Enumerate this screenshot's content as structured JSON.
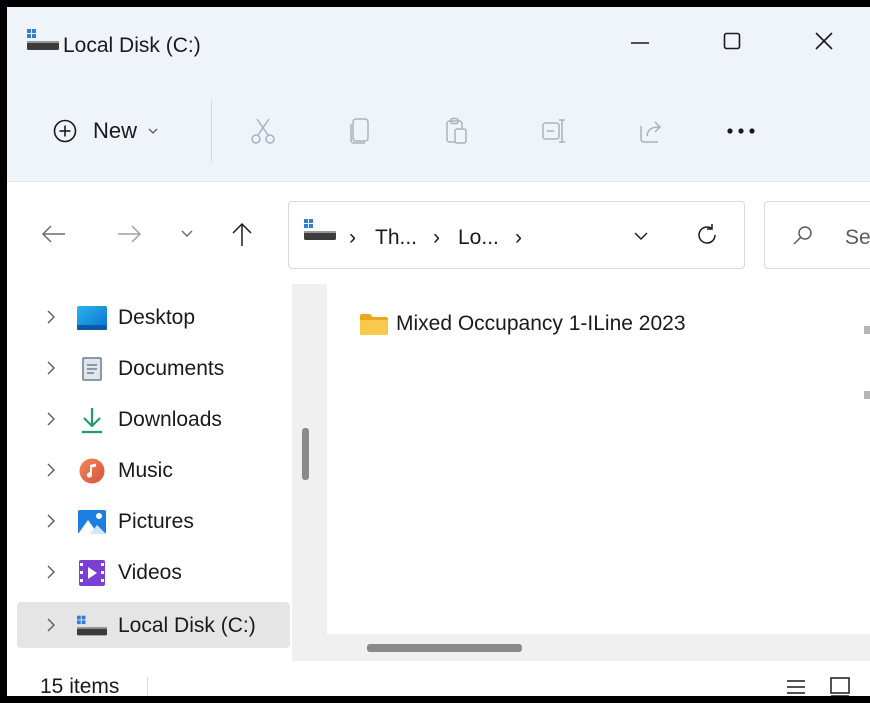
{
  "window": {
    "title": "Local Disk (C:)",
    "controls": [
      "minimize",
      "maximize",
      "close"
    ]
  },
  "command_bar": {
    "new_label": "New",
    "tools": [
      "cut-icon",
      "copy-icon",
      "paste-icon",
      "rename-icon",
      "share-icon",
      "more-icon"
    ]
  },
  "address_bar": {
    "crumbs": [
      "Th...",
      "Lo..."
    ],
    "separator": "›",
    "search_placeholder": "Search Local Disk (C:)"
  },
  "nav_pane": {
    "items": [
      {
        "label": "Desktop",
        "icon": "desktop-icon"
      },
      {
        "label": "Documents",
        "icon": "documents-icon"
      },
      {
        "label": "Downloads",
        "icon": "downloads-icon"
      },
      {
        "label": "Music",
        "icon": "music-icon"
      },
      {
        "label": "Pictures",
        "icon": "pictures-icon"
      },
      {
        "label": "Videos",
        "icon": "videos-icon"
      },
      {
        "label": "Local Disk (C:)",
        "icon": "drive-icon",
        "selected": true
      }
    ]
  },
  "content": {
    "items": [
      {
        "name": "Mixed Occupancy 1-ILine 2023",
        "type": "folder"
      }
    ]
  },
  "status_bar": {
    "item_count": "15 items"
  },
  "colors": {
    "header_bg": "#eff4fa",
    "selected_bg": "#e5e5e5",
    "folder": "#f8c94a",
    "accent": "#0067c0"
  }
}
